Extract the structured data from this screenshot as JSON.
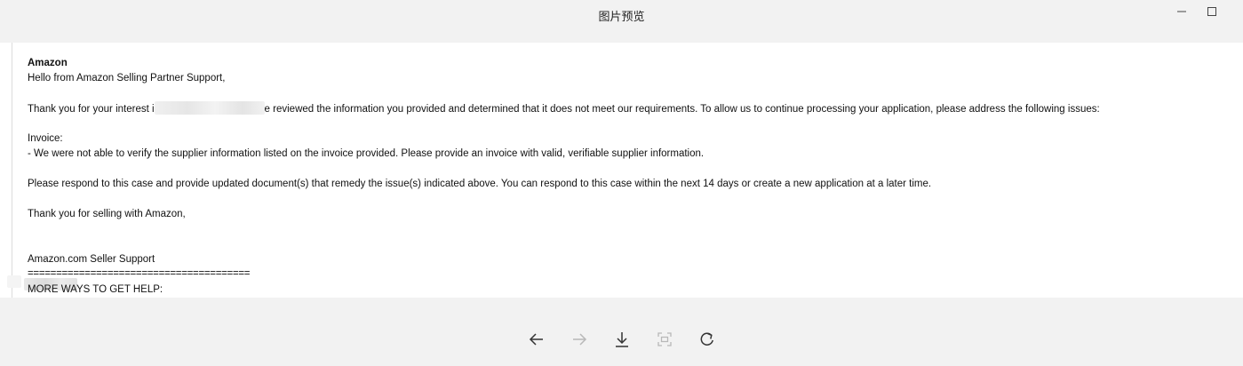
{
  "window": {
    "title": "图片预览",
    "controls": [
      "minimize-icon",
      "maximize-icon"
    ]
  },
  "email": {
    "sender": "Amazon",
    "greeting": "Hello from Amazon Selling Partner Support,",
    "para1_start": "Thank you for your interest i",
    "para1_end": "e reviewed the information you provided and determined that it does not meet our requirements. To allow us to continue processing your application, please address the following issues:",
    "section_heading": "Invoice:",
    "issue": "- We were not able to verify the supplier information listed on the invoice provided. Please provide an invoice with valid, verifiable supplier information.",
    "para2": "Please respond to this case and provide updated document(s) that remedy the issue(s) indicated above. You can respond to this case within the next 14 days or create a new application at a later time.",
    "closing": "Thank you for selling with Amazon,",
    "signature": "Amazon.com Seller Support",
    "divider": "=======================================",
    "more_help": "MORE WAYS TO GET HELP:"
  },
  "toolbar": {
    "items": [
      {
        "icon": "arrow-left-icon",
        "enabled": true
      },
      {
        "icon": "arrow-right-icon",
        "enabled": false
      },
      {
        "icon": "download-icon",
        "enabled": true
      },
      {
        "icon": "fit-screen-icon",
        "enabled": false
      },
      {
        "icon": "rotate-icon",
        "enabled": true
      }
    ]
  },
  "colors": {
    "background": "#f2f2f2",
    "viewer": "#ffffff",
    "icon_active": "#333333",
    "icon_disabled": "#b8b8b8"
  }
}
